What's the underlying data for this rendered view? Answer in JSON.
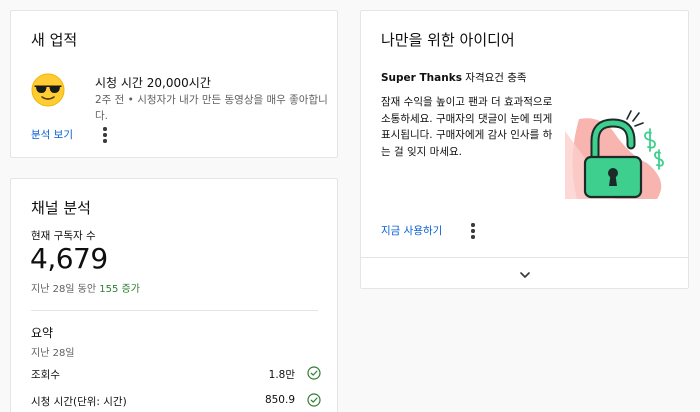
{
  "achievement": {
    "title": "새 업적",
    "headline": "시청 시간 20,000시간",
    "description": "2주 전 • 시청자가 내가 만든 동영상을 매우 좋아합니다.",
    "link": "분석 보기",
    "icon": "sunglasses-emoji-icon"
  },
  "analytics": {
    "title": "채널 분석",
    "subs_label": "현재 구독자 수",
    "subs_count": "4,679",
    "subs_change_prefix": "지난 28일 동안",
    "subs_change_value": "155 증가",
    "summary_title": "요약",
    "summary_period": "지난 28일",
    "metrics": [
      {
        "label": "조회수",
        "value": "1.8만"
      },
      {
        "label": "시청 시간(단위: 시간)",
        "value": "850.9"
      }
    ]
  },
  "ideas": {
    "title": "나만을 위한 아이디어",
    "subtitle_bold": "Super Thanks",
    "subtitle_rest": " 자격요건 충족",
    "body": "잠재 수익을 높이고 팬과 더 효과적으로 소통하세요. 구매자의 댓글이 눈에 띄게 표시됩니다. 구매자에게 감사 인사를 하는 걸 잊지 마세요.",
    "link": "지금 사용하기"
  },
  "colors": {
    "link": "#065fd4",
    "green": "#2e7d32",
    "lock": "#3ecf8e",
    "illustration_bg": "#f8b4ae"
  }
}
